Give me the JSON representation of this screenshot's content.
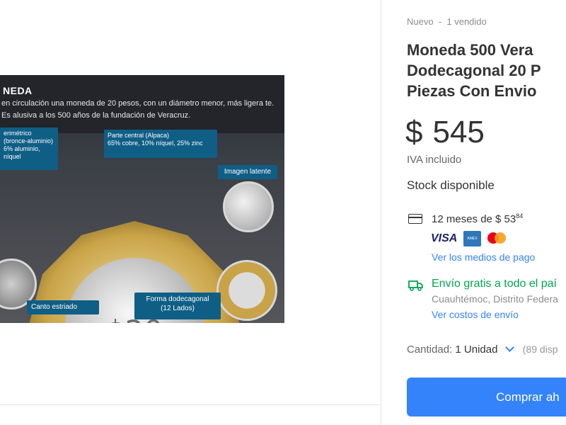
{
  "product": {
    "condition": "Nuevo",
    "sold": "1 vendido",
    "title_lines": "Moneda 500 Vera\nDodecagonal 20 P\nPiezas Con Envio",
    "currency_symbol": "$",
    "price": "545",
    "tax_note": "IVA incluido",
    "stock": "Stock disponible"
  },
  "payment": {
    "installments_text": "12 meses de $ 53",
    "installments_cents": "84",
    "brands": [
      "VISA",
      "AMEX",
      "mastercard"
    ],
    "link": "Ver los medios de pago"
  },
  "shipping": {
    "text": "Envío gratis a todo el paí",
    "location": "Cuauhtémoc, Distrito Federa",
    "link": "Ver costos de envío"
  },
  "quantity": {
    "label": "Cantidad:",
    "value": "1 Unidad",
    "available": "(89 disp"
  },
  "buy_button": "Comprar ah",
  "infographic": {
    "title": "NEDA",
    "description": "en circulación una moneda de 20 pesos, con un diámetro menor, más ligera te. Es alusiva a los 500 años de la fundación de Veracruz.",
    "callout_perimeter": "erimétrico\n(bronce-aluminio)\n6% aluminio,\nníquel",
    "callout_center": "Parte central (Alpaca)\n65% cobre, 10% níquel, 25% zinc",
    "callout_latent": "Imagen latente",
    "callout_edge": "Canto estriado",
    "callout_shape": "Forma dodecagonal\n(12 Lados)"
  },
  "colors": {
    "accent": "#3483fa",
    "shipping_green": "#00a650",
    "callout_blue": "#0f5e86"
  }
}
